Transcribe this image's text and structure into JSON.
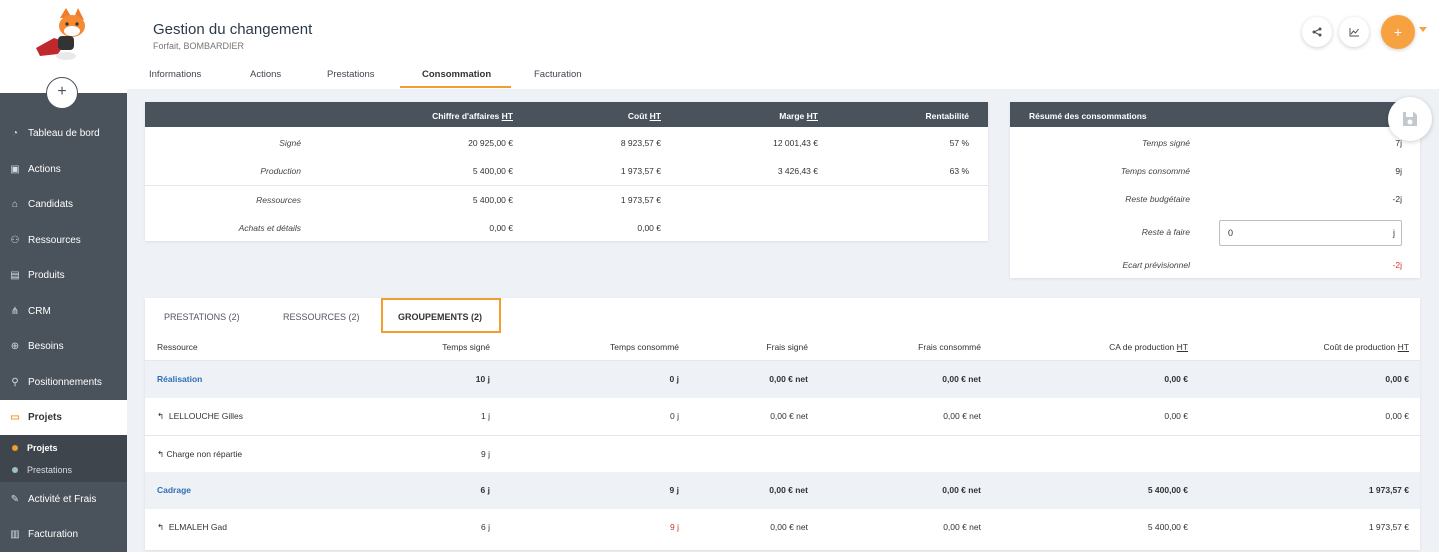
{
  "sidebar": {
    "add_label": "+",
    "items": [
      {
        "label": "Tableau de bord",
        "icon": "dashboard-icon",
        "glyph": "◔"
      },
      {
        "label": "Actions",
        "icon": "calendar-check-icon",
        "glyph": "▣"
      },
      {
        "label": "Candidats",
        "icon": "graduation-cap-icon",
        "glyph": "⌂"
      },
      {
        "label": "Ressources",
        "icon": "users-icon",
        "glyph": "⚇"
      },
      {
        "label": "Produits",
        "icon": "document-icon",
        "glyph": "▤"
      },
      {
        "label": "CRM",
        "icon": "sitemap-icon",
        "glyph": "⋔"
      },
      {
        "label": "Besoins",
        "icon": "target-icon",
        "glyph": "⊕"
      },
      {
        "label": "Positionnements",
        "icon": "pin-icon",
        "glyph": "⚲"
      },
      {
        "label": "Projets",
        "icon": "briefcase-icon",
        "glyph": "▭"
      },
      {
        "label": "Activité et Frais",
        "icon": "edit-icon",
        "glyph": "✎"
      },
      {
        "label": "Facturation",
        "icon": "invoice-icon",
        "glyph": "▥"
      }
    ],
    "sub_items": [
      {
        "label": "Projets",
        "color": "#f39c2f"
      },
      {
        "label": "Prestations",
        "color": "#9fc1bc"
      }
    ]
  },
  "header": {
    "title": "Gestion du changement",
    "subtitle": "Forfait, BOMBARDIER",
    "plus_label": "+",
    "tabs": [
      "Informations",
      "Actions",
      "Prestations",
      "Consommation",
      "Facturation"
    ]
  },
  "finance": {
    "headers": [
      "Chiffre d'affaires",
      "Coût",
      "Marge",
      "Rentabilité"
    ],
    "ht": "HT",
    "rows": [
      {
        "label": "Signé",
        "ca": "20 925,00 €",
        "cout": "8 923,57 €",
        "marge": "12 001,43 €",
        "rent": "57 %"
      },
      {
        "label": "Production",
        "ca": "5 400,00 €",
        "cout": "1 973,57 €",
        "marge": "3 426,43 €",
        "rent": "63 %"
      },
      {
        "label": "Ressources",
        "ca": "5 400,00 €",
        "cout": "1 973,57 €",
        "marge": "",
        "rent": ""
      },
      {
        "label": "Achats et détails",
        "ca": "0,00 €",
        "cout": "0,00 €",
        "marge": "",
        "rent": ""
      }
    ]
  },
  "resume": {
    "title": "Résumé des consommations",
    "rows": [
      {
        "label": "Temps signé",
        "value": "7",
        "unit": "j"
      },
      {
        "label": "Temps consommé",
        "value": "9",
        "unit": "j"
      },
      {
        "label": "Reste budgétaire",
        "value": "-2",
        "unit": "j"
      },
      {
        "label": "Reste à faire",
        "value": "0",
        "unit": "j"
      },
      {
        "label": "Ecart prévisionnel",
        "value": "-2",
        "unit": "j",
        "color": "#d0312d"
      }
    ]
  },
  "bottom": {
    "tabs": [
      "PRESTATIONS (2)",
      "RESSOURCES (2)",
      "GROUPEMENTS (2)"
    ],
    "columns": [
      "Ressource",
      "Temps signé",
      "Temps consommé",
      "Frais signé",
      "Frais consommé",
      "CA de production",
      "Coût de production"
    ],
    "ht": "HT",
    "rows": [
      {
        "type": "group",
        "name": "Réalisation",
        "ts": "10",
        "tc": "0",
        "fs": "0,00 € net",
        "fc": "0,00 € net",
        "ca": "0,00 €",
        "cp": "0,00 €"
      },
      {
        "type": "item",
        "name": "LELLOUCHE Gilles",
        "ts": "1",
        "tc": "0",
        "fs": "0,00 € net",
        "fc": "0,00 € net",
        "ca": "0,00 €",
        "cp": "0,00 €"
      },
      {
        "type": "item",
        "name": "Charge non répartie",
        "ts": "9",
        "tc": "",
        "fs": "",
        "fc": "",
        "ca": "",
        "cp": ""
      },
      {
        "type": "group",
        "name": "Cadrage",
        "ts": "6",
        "tc": "9",
        "fs": "0,00 € net",
        "fc": "0,00 € net",
        "ca": "5 400,00 €",
        "cp": "1 973,57 €"
      },
      {
        "type": "item",
        "name": "ELMALEH Gad",
        "ts": "6",
        "tc": "9",
        "tc_red": true,
        "fs": "0,00 € net",
        "fc": "0,00 € net",
        "ca": "5 400,00 €",
        "cp": "1 973,57 €"
      }
    ],
    "unit": "j"
  }
}
